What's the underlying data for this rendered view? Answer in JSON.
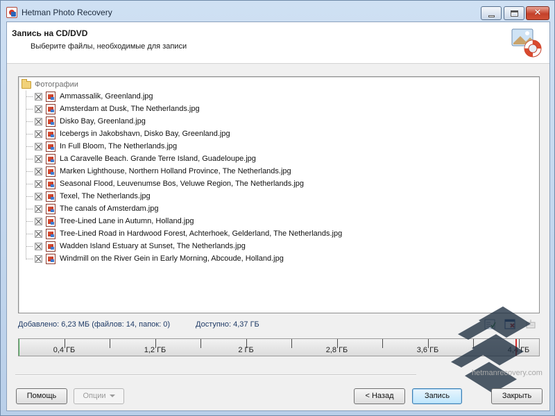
{
  "window": {
    "title": "Hetman Photo Recovery"
  },
  "header": {
    "title": "Запись на CD/DVD",
    "subtitle": "Выберите файлы, необходимые для записи"
  },
  "tree": {
    "root_label": "Фотографии",
    "files": [
      "Ammassalik, Greenland.jpg",
      "Amsterdam at Dusk, The Netherlands.jpg",
      "Disko Bay, Greenland.jpg",
      "Icebergs in Jakobshavn, Disko Bay, Greenland.jpg",
      "In Full Bloom, The Netherlands.jpg",
      "La Caravelle Beach. Grande Terre Island, Guadeloupe.jpg",
      "Marken Lighthouse, Northern Holland Province, The Netherlands.jpg",
      "Seasonal Flood, Leuvenumse Bos, Veluwe Region, The Netherlands.jpg",
      "Texel, The Netherlands.jpg",
      "The canals of Amsterdam.jpg",
      "Tree-Lined Lane in Autumn, Holland.jpg",
      "Tree-Lined Road in Hardwood Forest, Achterhoek, Gelderland, The Netherlands.jpg",
      "Wadden Island Estuary at Sunset, The Netherlands.jpg",
      "Windmill on the River Gein in Early Morning, Abcoude, Holland.jpg"
    ]
  },
  "stats": {
    "added": "Добавлено: 6,23 МБ (файлов: 14, папок: 0)",
    "free": "Доступно: 4,37 ГБ"
  },
  "capacity": {
    "used_fraction": 0.0014,
    "limit_fraction": 0.955,
    "ticks": [
      "0,4 ГБ",
      "1,2 ГБ",
      "2 ГБ",
      "2,8 ГБ",
      "3,6 ГБ",
      "4,4 ГБ"
    ],
    "fill_color": "#3aa84a",
    "limit_color": "#d22a2a"
  },
  "watermark": "hetmanrecovery.com",
  "buttons": {
    "help": "Помощь",
    "options": "Опции",
    "back": "< Назад",
    "write": "Запись",
    "close": "Закрыть"
  }
}
